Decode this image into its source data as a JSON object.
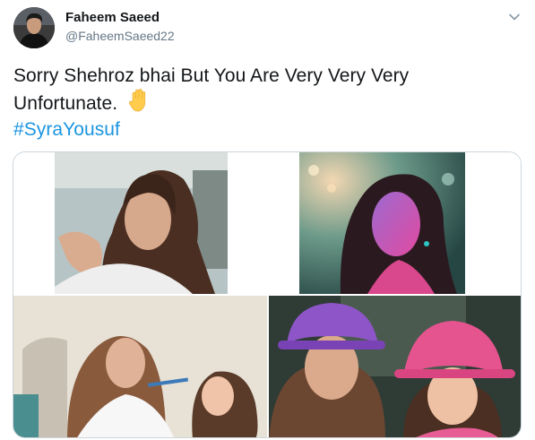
{
  "author": {
    "name": "Faheem Saeed",
    "handle": "@FaheemSaeed22",
    "avatar_icon": "profile-avatar"
  },
  "menu": {
    "icon": "chevron-down-icon"
  },
  "tweet": {
    "line1": "Sorry Shehroz bhai But You Are Very Very Very",
    "line2": "Unfortunate.",
    "emoji": "raised-hand-emoji",
    "hashtag": "#SyraYousuf"
  },
  "colors": {
    "link": "#1b95e0",
    "text": "#14171a",
    "secondary": "#657786",
    "border": "#ccd6dd",
    "emoji": "#ffcc4d"
  },
  "media": {
    "count": 4,
    "photos": [
      {
        "subject": "woman-applying-makeup-photo"
      },
      {
        "subject": "woman-neon-portrait-photo"
      },
      {
        "subject": "woman-painting-childs-face-photo"
      },
      {
        "subject": "woman-and-child-in-hats-photo"
      }
    ]
  }
}
